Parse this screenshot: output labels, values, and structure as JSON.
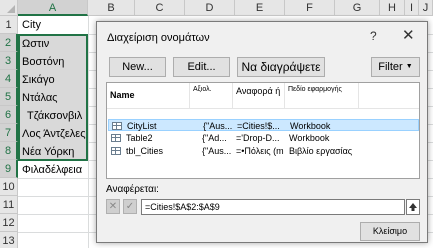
{
  "sheet": {
    "columns": [
      "A",
      "B",
      "C",
      "D",
      "E",
      "F",
      "G",
      "H",
      "I",
      "J"
    ],
    "rows": [
      "1",
      "2",
      "3",
      "4",
      "5",
      "6",
      "7",
      "8",
      "9",
      "10",
      "11",
      "12",
      "13"
    ],
    "cells": [
      "City",
      "Ωστιν",
      "Βοστόνη",
      "Σικάγο",
      "Ντάλας",
      "Τζάκσονβιλ",
      "Λος Άντζελες",
      "Νέα Υόρκη",
      "Φιλαδέλφεια"
    ]
  },
  "dialog": {
    "title": "Διαχείριση ονομάτων",
    "help_icon": "?",
    "close_icon": "✕",
    "new_label": "New...",
    "edit_label": "Edit...",
    "delete_label": "Να διαγράψετε",
    "filter_label": "Filter",
    "columns": {
      "name": "Name",
      "value": "Αξιολ.",
      "refers_to": "Αναφορά ή",
      "scope": "Πεδίο εφαρμογής"
    },
    "names": [
      {
        "name": "CityList",
        "value": "{\"Aus...",
        "refers_to": "=Cities!$...",
        "scope": "Workbook"
      },
      {
        "name": "Table2",
        "value": "{\"Ad...",
        "refers_to": "='Drop-D...",
        "scope": "Workbook"
      },
      {
        "name": "tbl_Cities",
        "value": "{\"Aus...",
        "refers_to": "=•Πόλεις (m",
        "scope": "Βιβλίο εργασίας"
      }
    ],
    "refers_to_label": "Αναφέρεται:",
    "refers_to_value": "=Cities!$A$2:$A$9",
    "close_label": "Κλείσιμο"
  }
}
